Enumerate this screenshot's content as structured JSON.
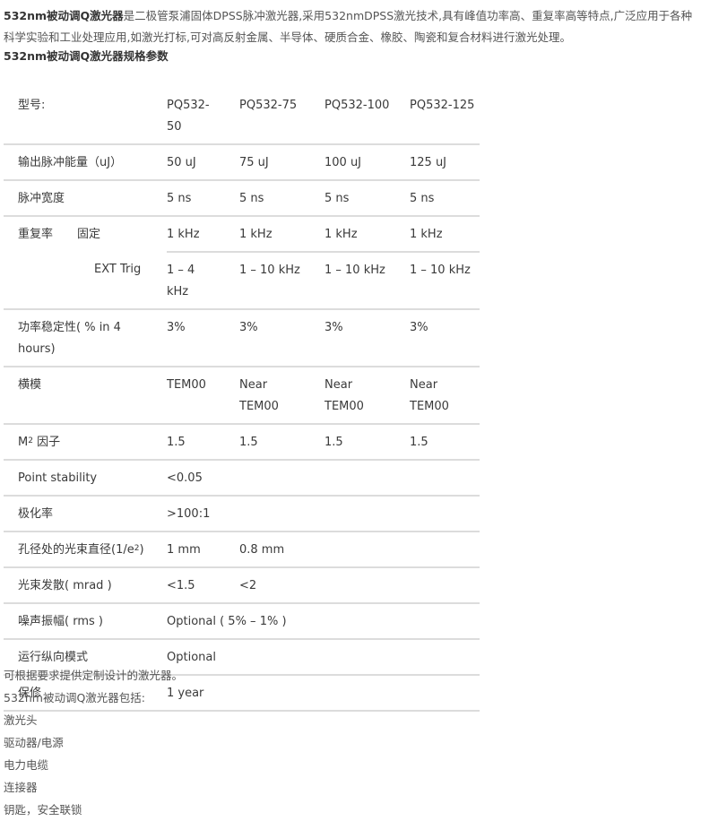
{
  "intro": {
    "product_bold": "532nm被动调Q激光器",
    "line1_rest": "是二极管泵浦固体DPSS脉冲激光器,采用532nmDPSS激光技术,具有峰值功率高、重复率高等特点,广泛应用于各种",
    "line2": "科学实验和工业处理应用,如激光打标,可对高反射金属、半导体、硬质合金、橡胶、陶瓷和复合材料进行激光处理。",
    "spec_title": "532nm被动调Q激光器规格参数"
  },
  "table": {
    "header": {
      "label": "型号:",
      "models": [
        "PQ532-50",
        "PQ532-75",
        "PQ532-100",
        "PQ532-125"
      ],
      "model1_line1": "PQ532-",
      "model1_line2": "50"
    },
    "pulse_energy": {
      "label": "输出脉冲能量（uJ）",
      "values": [
        "50 uJ",
        "75 uJ",
        "100 uJ",
        "125 uJ"
      ]
    },
    "pulse_width": {
      "label": "脉冲宽度",
      "values": [
        "5 ns",
        "5 ns",
        "5 ns",
        "5 ns"
      ]
    },
    "rep_rate": {
      "label": "重复率",
      "fixed_label": "固定",
      "fixed_values": [
        "1 kHz",
        "1 kHz",
        "1 kHz",
        "1 kHz"
      ],
      "ext_label": "EXT Trig",
      "ext_value1_line1": "1 – 4",
      "ext_value1_line2": "kHz",
      "ext_values": [
        "1 – 10 kHz",
        "1 – 10 kHz",
        "1 – 10 kHz"
      ]
    },
    "power_stability": {
      "label_line1": "功率稳定性( % in 4",
      "label_line2": "hours)",
      "values": [
        "3%",
        "3%",
        "3%",
        "3%"
      ]
    },
    "transverse_mode": {
      "label": "横模",
      "value1": "TEM00",
      "near": "Near",
      "tem": "TEM00"
    },
    "m2": {
      "label_prefix": "M",
      "label_sup": "2",
      "label_suffix": " 因子",
      "values": [
        "1.5",
        "1.5",
        "1.5",
        "1.5"
      ]
    },
    "point_stability": {
      "label": "Point stability",
      "value": "<0.05"
    },
    "polarization": {
      "label": "极化率",
      "value": ">100:1"
    },
    "beam_diameter": {
      "label_prefix": "孔径处的光束直径(1/e",
      "label_sup": "2",
      "label_suffix": ")",
      "values": [
        "1 mm",
        "0.8 mm"
      ]
    },
    "divergence": {
      "label": "光束发散( mrad )",
      "values": [
        "<1.5",
        "<2"
      ]
    },
    "noise": {
      "label": "噪声振幅( rms )",
      "value": "Optional ( 5% – 1% )"
    },
    "longitudinal": {
      "label": "运行纵向模式",
      "value": "Optional"
    },
    "warranty": {
      "label": "保修",
      "value": "1 year"
    }
  },
  "outro": {
    "lines": [
      "可根据要求提供定制设计的激光器。",
      "532nm被动调Q激光器包括:",
      "激光头",
      "驱动器/电源",
      "电力电缆",
      "连接器",
      "钥匙，安全联锁"
    ]
  }
}
